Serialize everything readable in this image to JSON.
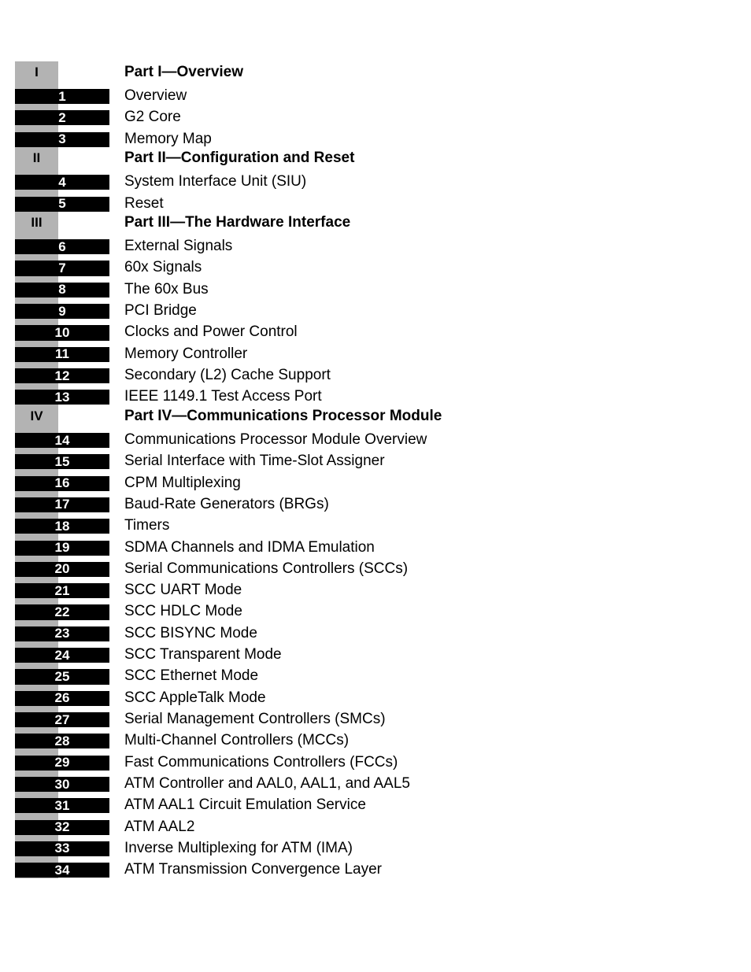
{
  "toc": [
    {
      "type": "part",
      "label": "I",
      "title": "Part I—Overview"
    },
    {
      "type": "chapter",
      "label": "1",
      "title": "Overview"
    },
    {
      "type": "chapter",
      "label": "2",
      "title": "G2 Core"
    },
    {
      "type": "chapter",
      "label": "3",
      "title": "Memory Map"
    },
    {
      "type": "part",
      "label": "II",
      "title": "Part II—Configuration and Reset"
    },
    {
      "type": "chapter",
      "label": "4",
      "title": "System Interface Unit (SIU)"
    },
    {
      "type": "chapter",
      "label": "5",
      "title": "Reset"
    },
    {
      "type": "part",
      "label": "III",
      "title": "Part III—The Hardware Interface"
    },
    {
      "type": "chapter",
      "label": "6",
      "title": "External Signals"
    },
    {
      "type": "chapter",
      "label": "7",
      "title": "60x Signals"
    },
    {
      "type": "chapter",
      "label": "8",
      "title": "The 60x Bus"
    },
    {
      "type": "chapter",
      "label": "9",
      "title": "PCI Bridge"
    },
    {
      "type": "chapter",
      "label": "10",
      "title": "Clocks and Power Control"
    },
    {
      "type": "chapter",
      "label": "11",
      "title": "Memory Controller"
    },
    {
      "type": "chapter",
      "label": "12",
      "title": "Secondary (L2) Cache Support"
    },
    {
      "type": "chapter",
      "label": "13",
      "title": "IEEE 1149.1 Test Access Port"
    },
    {
      "type": "part",
      "label": "IV",
      "title": "Part IV—Communications Processor Module"
    },
    {
      "type": "chapter",
      "label": "14",
      "title": "Communications Processor Module Overview"
    },
    {
      "type": "chapter",
      "label": "15",
      "title": "Serial Interface with Time-Slot Assigner"
    },
    {
      "type": "chapter",
      "label": "16",
      "title": "CPM Multiplexing"
    },
    {
      "type": "chapter",
      "label": "17",
      "title": "Baud-Rate Generators (BRGs)"
    },
    {
      "type": "chapter",
      "label": "18",
      "title": "Timers"
    },
    {
      "type": "chapter",
      "label": "19",
      "title": "SDMA Channels and IDMA Emulation"
    },
    {
      "type": "chapter",
      "label": "20",
      "title": "Serial Communications Controllers (SCCs)"
    },
    {
      "type": "chapter",
      "label": "21",
      "title": "SCC UART Mode"
    },
    {
      "type": "chapter",
      "label": "22",
      "title": "SCC HDLC Mode"
    },
    {
      "type": "chapter",
      "label": "23",
      "title": "SCC BISYNC Mode"
    },
    {
      "type": "chapter",
      "label": "24",
      "title": "SCC Transparent Mode"
    },
    {
      "type": "chapter",
      "label": "25",
      "title": "SCC Ethernet Mode"
    },
    {
      "type": "chapter",
      "label": "26",
      "title": "SCC AppleTalk Mode"
    },
    {
      "type": "chapter",
      "label": "27",
      "title": "Serial Management Controllers (SMCs)"
    },
    {
      "type": "chapter",
      "label": "28",
      "title": "Multi-Channel Controllers (MCCs)"
    },
    {
      "type": "chapter",
      "label": "29",
      "title": "Fast Communications Controllers (FCCs)"
    },
    {
      "type": "chapter",
      "label": "30",
      "title": "ATM Controller and AAL0, AAL1, and AAL5"
    },
    {
      "type": "chapter",
      "label": "31",
      "title": "ATM AAL1 Circuit Emulation Service"
    },
    {
      "type": "chapter",
      "label": "32",
      "title": "ATM AAL2"
    },
    {
      "type": "chapter",
      "label": "33",
      "title": "Inverse Multiplexing for ATM (IMA)"
    },
    {
      "type": "chapter",
      "label": "34",
      "title": "ATM Transmission Convergence Layer"
    }
  ]
}
